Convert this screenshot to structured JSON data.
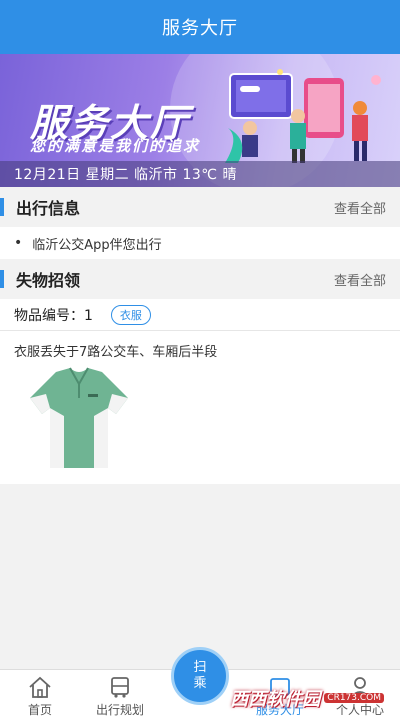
{
  "header": {
    "title": "服务大厅"
  },
  "banner": {
    "title": "服务大厅",
    "slogan": "您的满意是我们的追求",
    "info": "12月21日 星期二 临沂市 13℃ 晴"
  },
  "travel": {
    "title": "出行信息",
    "more": "查看全部",
    "items": [
      "临沂公交App伴您出行"
    ]
  },
  "lost": {
    "title": "失物招领",
    "more": "查看全部",
    "item": {
      "number_label": "物品编号：1",
      "tag": "衣服",
      "description": "衣服丢失于7路公交车、车厢后半段"
    }
  },
  "tabs": [
    {
      "label": "首页",
      "icon": "home-icon"
    },
    {
      "label": "出行规划",
      "icon": "bus-icon"
    },
    {
      "label": "",
      "icon": ""
    },
    {
      "label": "服务大厅",
      "icon": "service-icon"
    },
    {
      "label": "个人中心",
      "icon": "person-icon"
    }
  ],
  "scan": {
    "line1": "扫",
    "line2": "乘"
  },
  "watermark": {
    "logo": "西西软件园",
    "url": "CR173.COM"
  },
  "colors": {
    "primary": "#2f8fe6",
    "banner": "#8a6fe0"
  }
}
